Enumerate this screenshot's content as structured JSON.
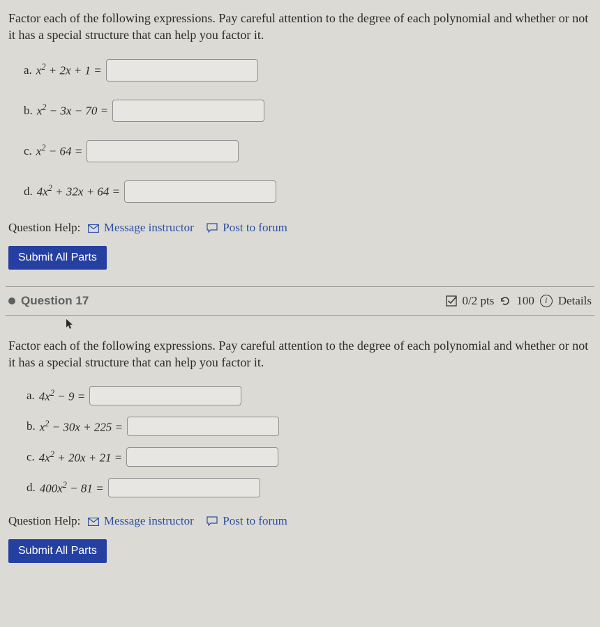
{
  "q16": {
    "instructions": "Factor each of the following expressions. Pay careful attention to the degree of each polynomial and whether or not it has a special structure that can help you factor it.",
    "parts": {
      "a": {
        "label": "a.",
        "expr_html": "x<span class='sup'>2</span> + 2x + 1 ="
      },
      "b": {
        "label": "b.",
        "expr_html": "x<span class='sup'>2</span> − 3x − 70 ="
      },
      "c": {
        "label": "c.",
        "expr_html": "x<span class='sup'>2</span> − 64 ="
      },
      "d": {
        "label": "d.",
        "expr_html": "4x<span class='sup'>2</span> + 32x + 64 ="
      }
    },
    "help_label": "Question Help:",
    "msg_instructor": "Message instructor",
    "post_forum": "Post to forum",
    "submit": "Submit All Parts"
  },
  "q17header": {
    "title": "Question 17",
    "pts": "0/2 pts",
    "attempts": "100",
    "details": "Details"
  },
  "q17": {
    "instructions": "Factor each of the following expressions. Pay careful attention to the degree of each polynomial and whether or not it has a special structure that can help you factor it.",
    "parts": {
      "a": {
        "label": "a.",
        "expr_html": "4x<span class='sup'>2</span> − 9 ="
      },
      "b": {
        "label": "b.",
        "expr_html": "x<span class='sup'>2</span> − 30x + 225 ="
      },
      "c": {
        "label": "c.",
        "expr_html": "4x<span class='sup'>2</span> + 20x + 21 ="
      },
      "d": {
        "label": "d.",
        "expr_html": "400x<span class='sup'>2</span> − 81 ="
      }
    },
    "help_label": "Question Help:",
    "msg_instructor": "Message instructor",
    "post_forum": "Post to forum",
    "submit": "Submit All Parts"
  }
}
